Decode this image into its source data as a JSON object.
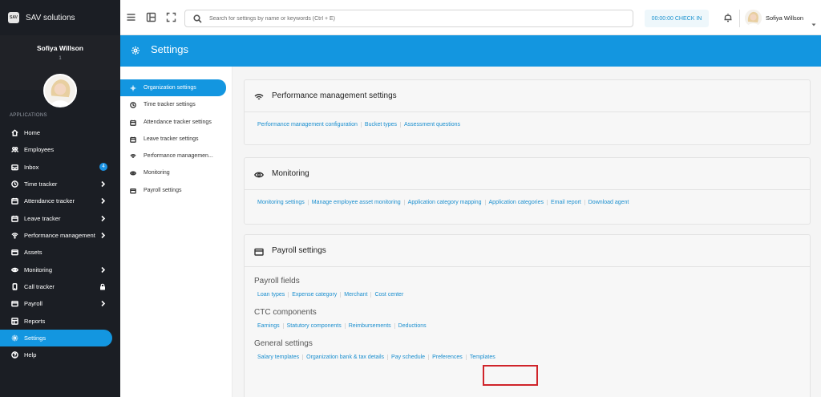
{
  "brand": {
    "logo_text": "SAV",
    "name": "SAV solutions"
  },
  "profile": {
    "name": "Sofiya Willson",
    "sub": "1"
  },
  "sidebar": {
    "section_label": "APPLICATIONS",
    "items": [
      {
        "label": "Home",
        "icon": "home-icon"
      },
      {
        "label": "Employees",
        "icon": "users-icon"
      },
      {
        "label": "Inbox",
        "icon": "inbox-icon",
        "badge": "4"
      },
      {
        "label": "Time tracker",
        "icon": "clock-icon"
      },
      {
        "label": "Attendance tracker",
        "icon": "calendar-icon"
      },
      {
        "label": "Leave tracker",
        "icon": "calendar-icon"
      },
      {
        "label": "Performance management",
        "icon": "wifi-icon"
      },
      {
        "label": "Assets",
        "icon": "box-icon"
      },
      {
        "label": "Monitoring",
        "icon": "eye-icon"
      },
      {
        "label": "Call tracker",
        "icon": "phone-icon"
      },
      {
        "label": "Payroll",
        "icon": "card-icon"
      },
      {
        "label": "Reports",
        "icon": "report-icon"
      },
      {
        "label": "Settings",
        "icon": "gear-icon",
        "active": true
      },
      {
        "label": "Help",
        "icon": "help-icon"
      }
    ]
  },
  "topbar": {
    "search_placeholder": "Search for settings by name or keywords (Ctrl + E)",
    "check_in": "00:00:00 CHECK IN",
    "user_name": "Sofiya Willson"
  },
  "header": {
    "title": "Settings"
  },
  "settings_menu": [
    {
      "label": "Organization settings",
      "active": true
    },
    {
      "label": "Time tracker settings"
    },
    {
      "label": "Attendance tracker settings"
    },
    {
      "label": "Leave tracker settings"
    },
    {
      "label": "Performance managemen..."
    },
    {
      "label": "Monitoring"
    },
    {
      "label": "Payroll settings"
    }
  ],
  "cards": {
    "performance": {
      "title": "Performance management settings",
      "links": [
        "Performance management configuration",
        "Bucket types",
        "Assessment questions"
      ]
    },
    "monitoring": {
      "title": "Monitoring",
      "links": [
        "Monitoring settings",
        "Manage employee asset monitoring",
        "Application category mapping",
        "Application categories",
        "Email report",
        "Download agent"
      ]
    },
    "payroll": {
      "title": "Payroll settings",
      "sections": [
        {
          "label": "Payroll fields",
          "links": [
            "Loan types",
            "Expense category",
            "Merchant",
            "Cost center"
          ]
        },
        {
          "label": "CTC components",
          "links": [
            "Earnings",
            "Statutory components",
            "Reimbursements",
            "Deductions"
          ]
        },
        {
          "label": "General settings",
          "links": [
            "Salary templates",
            "Organization bank & tax details",
            "Pay schedule",
            "Preferences",
            "Templates"
          ]
        }
      ]
    }
  },
  "colors": {
    "accent": "#1396e0",
    "sidebar_bg": "#1b1e24",
    "link": "#1b8fcf",
    "highlight": "#d0242a"
  }
}
